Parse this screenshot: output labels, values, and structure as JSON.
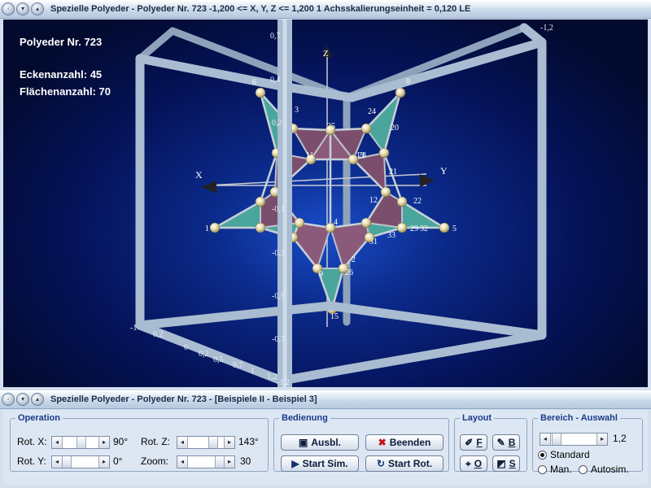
{
  "main_window": {
    "title": "Spezielle Polyeder - Polyeder Nr. 723   -1,200 <= X, Y, Z <= 1,200     1 Achsskalierungseinheit = 0,120 LE"
  },
  "scene": {
    "info_name": "Polyeder Nr. 723",
    "info_vertices": "Eckenanzahl: 45",
    "info_faces": "Flächenanzahl: 70",
    "axis_x": "X",
    "axis_y": "Y",
    "axis_z": "Z",
    "z_ticks": [
      "0,7",
      "0,4",
      "0,2",
      "-0,1",
      "-0,3",
      "-0,5",
      "-0,7",
      "-1,2"
    ],
    "corner_top_right": "-1,2",
    "bottom_ticks": [
      "-1",
      "0,2",
      "0",
      "0,2",
      "0,5",
      "0,7",
      "1",
      "1,2"
    ],
    "vertex_labels": [
      "0",
      "1",
      "2",
      "3",
      "4",
      "5",
      "6",
      "9",
      "11",
      "12",
      "13",
      "15",
      "20",
      "21",
      "22",
      "24",
      "25",
      "26",
      "28",
      "29",
      "31",
      "32",
      "33"
    ],
    "colors": {
      "face_teal": "#4aa59c",
      "face_mauve": "#7c4e6e",
      "frame": "#a9bcd1",
      "vertex": "#e0d6a6"
    }
  },
  "control_window": {
    "title": "Spezielle Polyeder - Polyeder Nr. 723 - [Beispiele II - Beispiel 3]"
  },
  "operation": {
    "legend": "Operation",
    "rot_x_label": "Rot. X:",
    "rot_x_value": "90°",
    "rot_y_label": "Rot. Y:",
    "rot_y_value": "0°",
    "rot_z_label": "Rot. Z:",
    "rot_z_value": "143°",
    "zoom_label": "Zoom:",
    "zoom_value": "30"
  },
  "bedienung": {
    "legend": "Bedienung",
    "ausbl": "Ausbl.",
    "beenden": "Beenden",
    "start_sim": "Start Sim.",
    "start_rot": "Start Rot."
  },
  "layout": {
    "legend": "Layout",
    "f": "F",
    "b": "B",
    "o": "O",
    "s": "S"
  },
  "bereich": {
    "legend": "Bereich - Auswahl",
    "value": "1,2",
    "standard": "Standard",
    "man": "Man.",
    "autosim": "Autosim."
  }
}
